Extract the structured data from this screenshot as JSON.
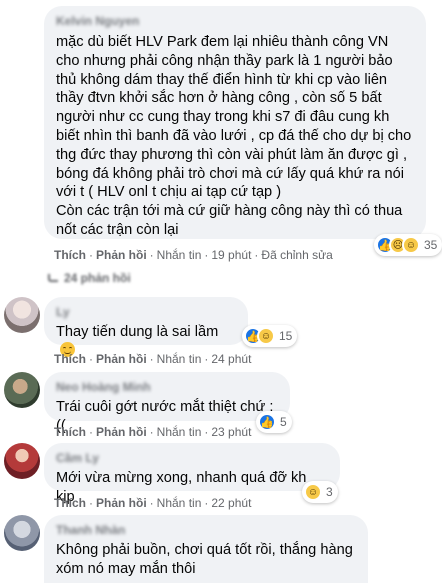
{
  "comments": [
    {
      "author": "Kelvin Nguyen",
      "text": "mặc dù biết HLV Park đem lại nhiêu thành công VN cho nhưng phải công nhận thầy park là 1 người bảo thủ không dám thay thế điển hình từ khi cp vào liên thầy đtvn khởi sắc hơn ở hàng công , còn số 5 bất người như cc cung thay trong khi s7 đi đâu cung kh biết nhìn thì banh đã vào lưới , cp đá thế cho dự bị cho thg đức thay phương thì còn vài phút làm ăn được gì , bóng đá không phải trò chơi mà cứ lấy quá khứ ra nói với t ( HLV onl t chịu ai tạp cứ tạp )\nCòn các trận tới mà cứ giữ hàng công này thì có thua nốt các trận còn lại",
      "like": "Thích",
      "reply": "Phản hồi",
      "message": "Nhắn tin",
      "time": "19 phút",
      "edited": "Đã chỉnh sửa",
      "reaction_count": "35",
      "replies_label": "24 phản hồi"
    },
    {
      "author": "Ly",
      "text": "Thay tiến dung là sai lầm",
      "like": "Thích",
      "reply": "Phản hồi",
      "message": "Nhắn tin",
      "time": "24 phút",
      "reaction_count": "15"
    },
    {
      "author": "Neo Hoàng Minh",
      "text": "Trái cuôi gớt nước mắt thiệt chứ :((",
      "like": "Thích",
      "reply": "Phản hồi",
      "message": "Nhắn tin",
      "time": "23 phút",
      "reaction_count": "5"
    },
    {
      "author": "Cầm Ly",
      "text": "Mới vừa mừng xong, nhanh quá đỡ kh kịp",
      "like": "Thích",
      "reply": "Phản hồi",
      "message": "Nhắn tin",
      "time": "22 phút",
      "reaction_count": "3"
    },
    {
      "author": "Thanh Nhàn",
      "text": "Không phải buồn, chơi quá tốt rồi, thắng hàng xóm nó may mắn thôi"
    }
  ],
  "separator": "·",
  "colors": {
    "bubble": "#f0f2f5",
    "like_blue": "#1b74e4",
    "haha_yellow": "#f7c948",
    "meta_gray": "#65676b"
  },
  "icons": [
    "like-reaction-icon",
    "haha-reaction-icon",
    "sad-reaction-icon",
    "reply-arrow-icon",
    "smile-emoji-icon"
  ]
}
